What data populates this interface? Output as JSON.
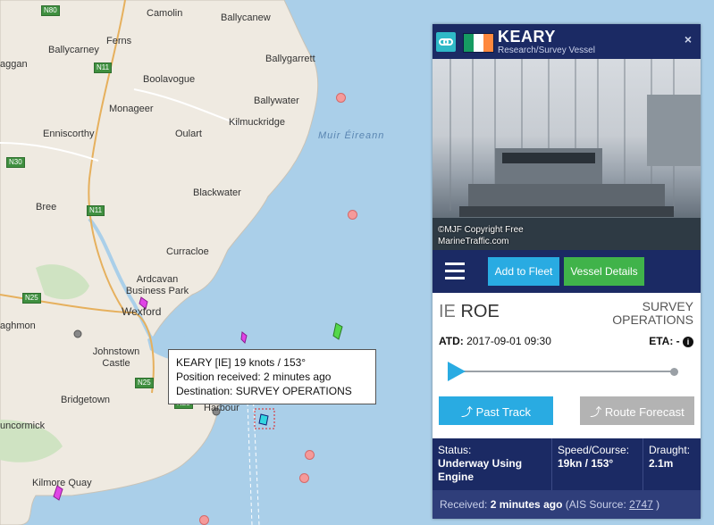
{
  "map": {
    "sea_label": "Muir Éireann",
    "places": [
      {
        "name": "Camolin"
      },
      {
        "name": "Ballycanew"
      },
      {
        "name": "Ballycarney"
      },
      {
        "name": "Ferns"
      },
      {
        "name": "Ballygarrett"
      },
      {
        "name": "aggan"
      },
      {
        "name": "Boolavogue"
      },
      {
        "name": "Monageer"
      },
      {
        "name": "Ballywater"
      },
      {
        "name": "Kilmuckridge"
      },
      {
        "name": "Enniscorthy"
      },
      {
        "name": "Oulart"
      },
      {
        "name": "Blackwater"
      },
      {
        "name": "Bree"
      },
      {
        "name": "Curracloe"
      },
      {
        "name": "Ardcavan Business Park"
      },
      {
        "name": "Wexford"
      },
      {
        "name": "aghmon"
      },
      {
        "name": "Johnstown Castle"
      },
      {
        "name": "Bridgetown"
      },
      {
        "name": "uncormick"
      },
      {
        "name": "Kilmore Quay"
      },
      {
        "name": "Harbour"
      }
    ],
    "roads": [
      "N80",
      "N11",
      "N30",
      "N11",
      "N25",
      "N25",
      "N25"
    ],
    "tooltip": {
      "line1": "KEARY [IE] 19 knots / 153°",
      "line2": "Position received: 2 minutes ago",
      "line3": "Destination: SURVEY OPERATIONS"
    }
  },
  "panel": {
    "vessel_name": "KEARY",
    "vessel_type": "Research/Survey Vessel",
    "flag_colors": [
      "#169b62",
      "#ffffff",
      "#ff883e"
    ],
    "close_symbol": "×",
    "photo_credit_line1": "©MJF Copyright Free",
    "photo_credit_line2": "MarineTraffic.com",
    "add_to_fleet": "Add to Fleet",
    "vessel_details": "Vessel Details",
    "dest_country": "IE",
    "dest_port": "ROE",
    "status_right_line1": "SURVEY",
    "status_right_line2": "OPERATIONS",
    "atd_label": "ATD:",
    "atd_value": "2017-09-01 09:30",
    "eta_label": "ETA:",
    "eta_value": "-",
    "past_track": "Past Track",
    "route_forecast": "Route Forecast",
    "status_label": "Status:",
    "status_value": "Underway Using Engine",
    "speed_label": "Speed/Course:",
    "speed_value": "19kn / 153°",
    "draught_label": "Draught:",
    "draught_value": "2.1m",
    "received_label": "Received:",
    "received_value": "2 minutes ago",
    "ais_source_label": "(AIS Source:",
    "ais_source_value": "2747",
    "ais_source_close": ")"
  },
  "colors": {
    "panel_header": "#1b2a64",
    "accent_blue": "#29abe2",
    "accent_green": "#40b34a",
    "land": "#efeae1",
    "sea": "#aacfe9"
  }
}
